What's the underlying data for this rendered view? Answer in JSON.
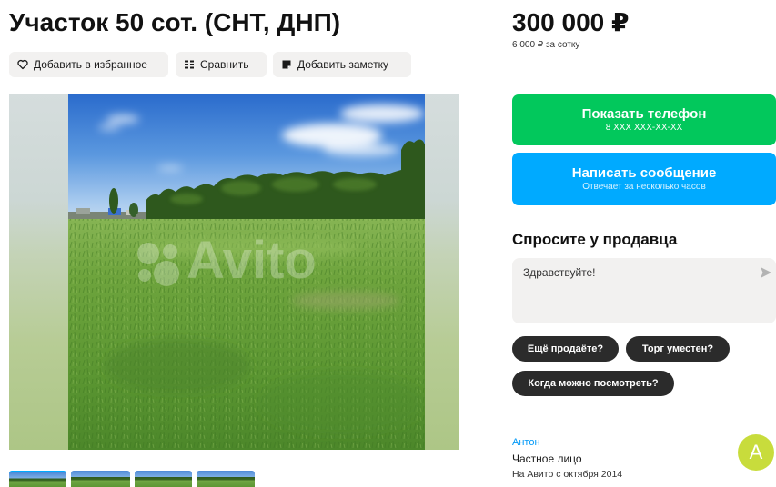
{
  "listing": {
    "title": "Участок 50 сот. (СНТ, ДНП)",
    "actions": [
      {
        "label": "Добавить в избранное",
        "icon": "heart-icon"
      },
      {
        "label": "Сравнить",
        "icon": "compare-icon"
      },
      {
        "label": "Добавить заметку",
        "icon": "note-icon"
      }
    ],
    "gallery": {
      "watermark": "Avito"
    }
  },
  "price": {
    "value": "300 000 ₽",
    "per_unit": "6 000 ₽ за сотку"
  },
  "contact": {
    "phone_label": "Показать телефон",
    "phone_masked": "8 XXX XXX-XX-XX",
    "message_label": "Написать сообщение",
    "message_sub": "Отвечает за несколько часов"
  },
  "ask": {
    "heading": "Спросите у продавца",
    "message": "Здравствуйте!",
    "send_icon": "send-icon",
    "quick_replies": [
      "Ещё продаёте?",
      "Торг уместен?",
      "Когда можно посмотреть?"
    ]
  },
  "seller": {
    "name": "Антон",
    "type": "Частное лицо",
    "since": "На Авито с октября 2014",
    "avatar_letter": "А"
  },
  "colors": {
    "green": "#02c85c",
    "blue": "#00aaff",
    "chip": "#2b2b2b",
    "link": "#0099f7",
    "avatar": "#c8dc3c",
    "button_bg": "#f2f1f0"
  }
}
